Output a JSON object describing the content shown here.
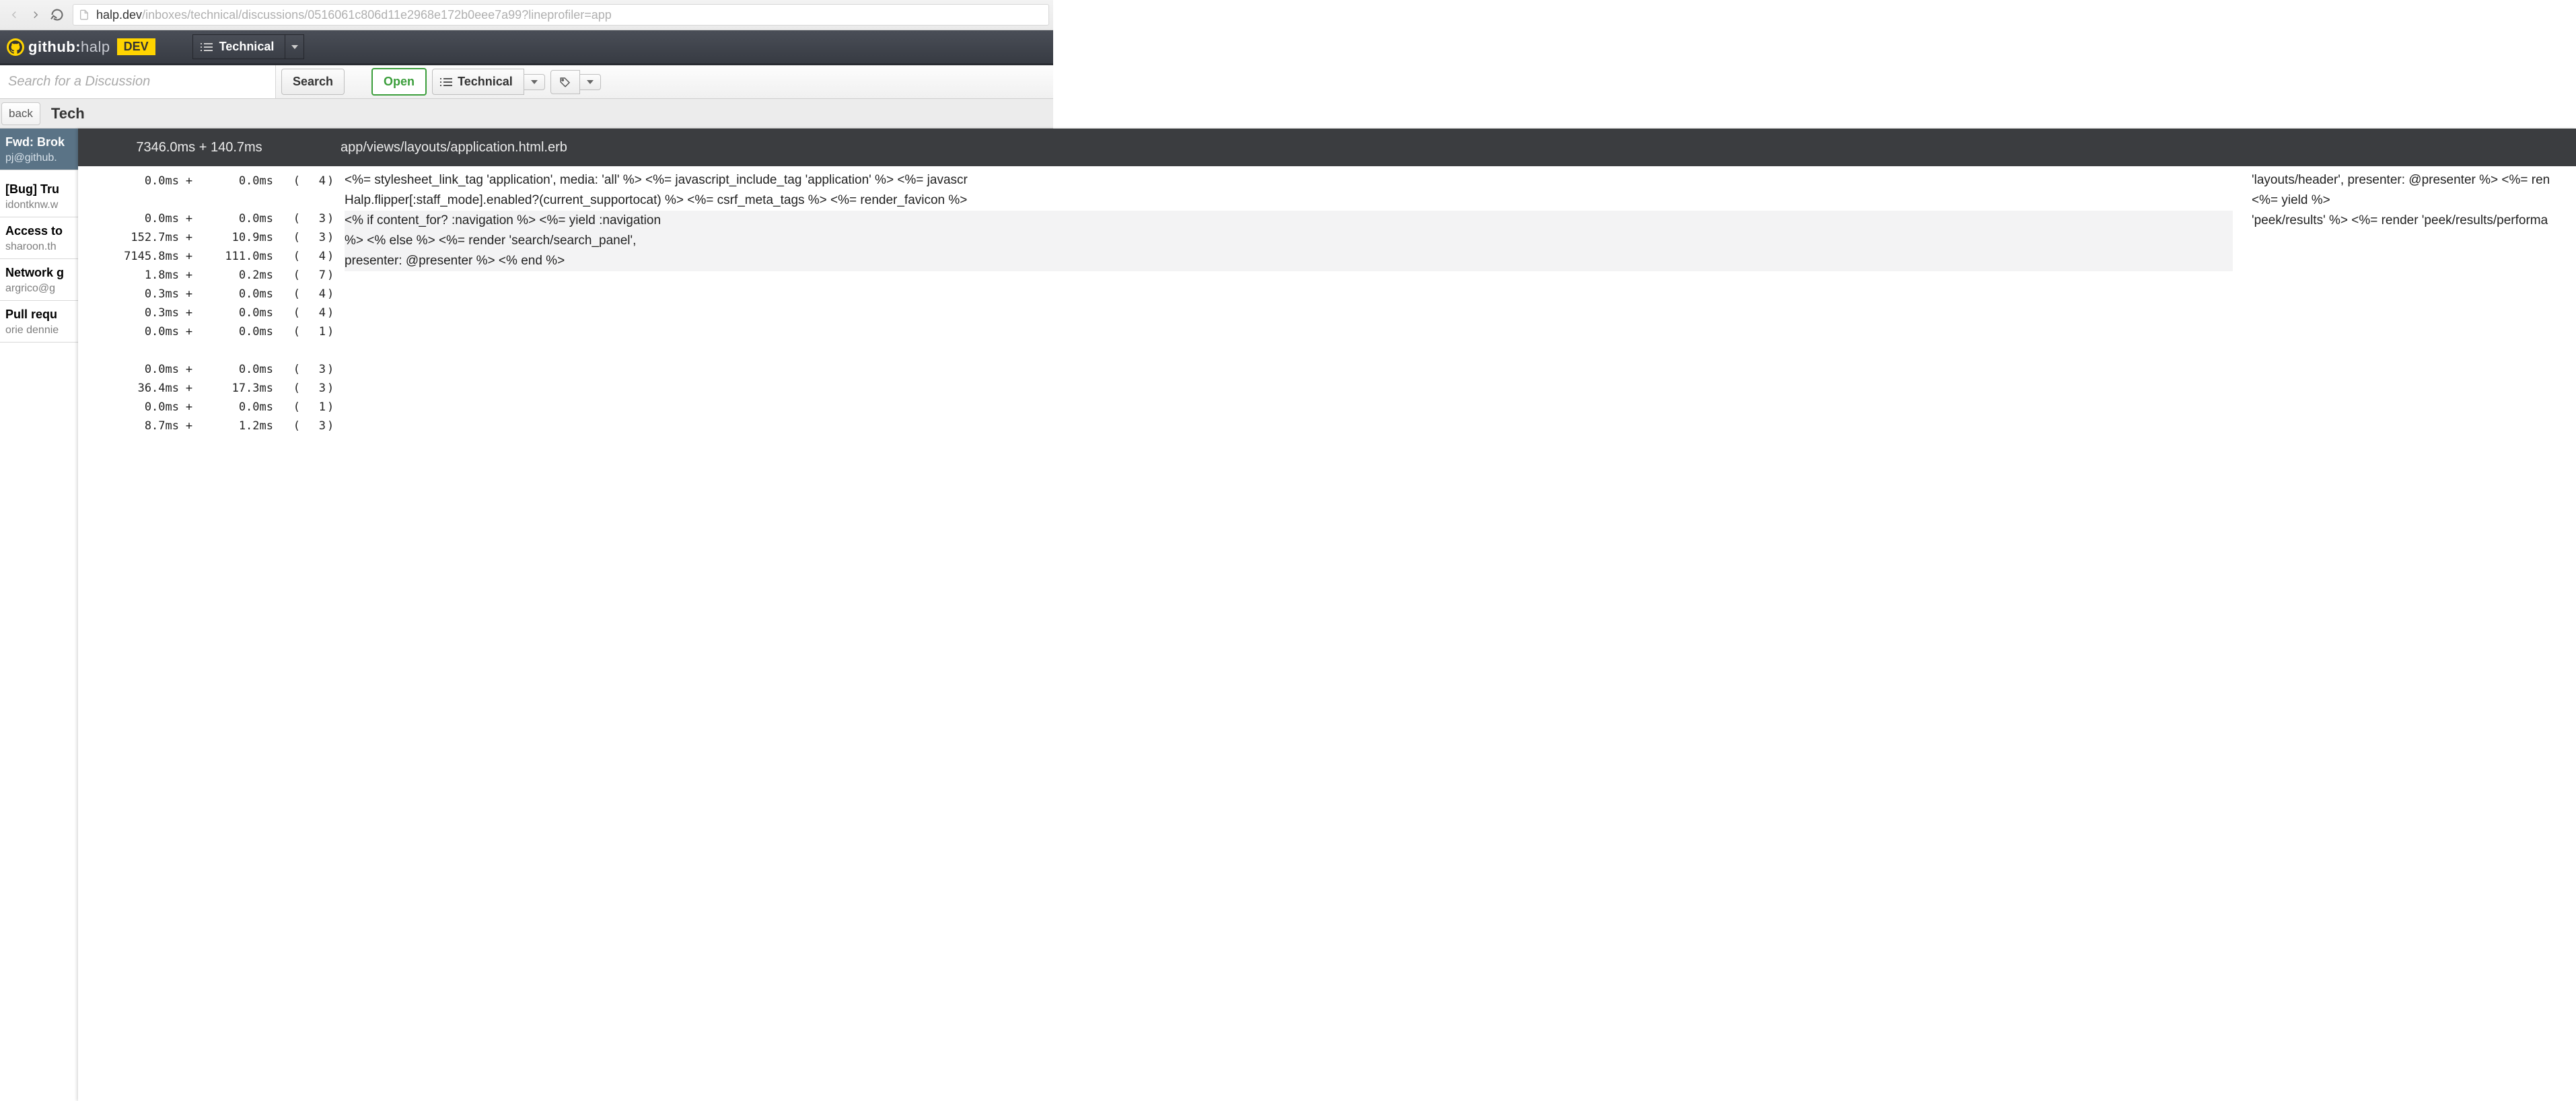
{
  "browser": {
    "url_host": "halp.dev",
    "url_path": "/inboxes/technical/discussions/0516061c806d11e2968e172b0eee7a99?lineprofiler=app"
  },
  "brand": {
    "github": "github:",
    "halp": "halp",
    "badge": "DEV"
  },
  "appbar": {
    "dropdown_label": "Technical"
  },
  "toolbar": {
    "search_placeholder": "Search for a Discussion",
    "search_button": "Search",
    "open_button": "Open",
    "technical_button": "Technical"
  },
  "sub": {
    "back": "back",
    "tab": "Tech"
  },
  "discussions": [
    {
      "title": "Fwd: Brok",
      "sub": "pj@github."
    },
    {
      "title": "[Bug] Tru",
      "sub": "idontknw.w"
    },
    {
      "title": "Access to",
      "sub": "sharoon.th"
    },
    {
      "title": "Network g",
      "sub": "argrico@g"
    },
    {
      "title": "Pull requ",
      "sub": "orie dennie"
    }
  ],
  "profiler": {
    "timing": "7346.0ms + 140.7ms",
    "path": "app/views/layouts/application.html.erb",
    "lines": [
      {
        "t1": "0.0ms",
        "t2": "0.0ms",
        "cnt": "4"
      },
      {
        "t1": "",
        "t2": "",
        "cnt": ""
      },
      {
        "t1": "0.0ms",
        "t2": "0.0ms",
        "cnt": "3"
      },
      {
        "t1": "152.7ms",
        "t2": "10.9ms",
        "cnt": "3"
      },
      {
        "t1": "7145.8ms",
        "t2": "111.0ms",
        "cnt": "4"
      },
      {
        "t1": "1.8ms",
        "t2": "0.2ms",
        "cnt": "7"
      },
      {
        "t1": "0.3ms",
        "t2": "0.0ms",
        "cnt": "4"
      },
      {
        "t1": "0.3ms",
        "t2": "0.0ms",
        "cnt": "4"
      },
      {
        "t1": "0.0ms",
        "t2": "0.0ms",
        "cnt": "1"
      },
      {
        "t1": "",
        "t2": "",
        "cnt": ""
      },
      {
        "t1": "0.0ms",
        "t2": "0.0ms",
        "cnt": "3"
      },
      {
        "t1": "36.4ms",
        "t2": "17.3ms",
        "cnt": "3"
      },
      {
        "t1": "0.0ms",
        "t2": "0.0ms",
        "cnt": "1"
      },
      {
        "t1": "8.7ms",
        "t2": "1.2ms",
        "cnt": "3"
      }
    ],
    "source": {
      "col1_l1": "<%= stylesheet_link_tag 'application', media: 'all' %> <%= javascript_include_tag 'application' %> <%= javascr",
      "col1_l2": "Halp.flipper[:staff_mode].enabled?(current_supportocat) %> <%= csrf_meta_tags %> <%= render_favicon %>",
      "col1_l3": "<% if content_for? :navigation %> <%= yield :navigation",
      "col1_l4": "%> <% else %> <%= render 'search/search_panel',",
      "col1_l5": "presenter: @presenter %> <% end %>",
      "col2_l1": "'layouts/header', presenter: @presenter %> <%= ren",
      "col2_l2": "<%= yield %>",
      "col2_l3": "'peek/results' %> <%= render 'peek/results/performa"
    }
  }
}
